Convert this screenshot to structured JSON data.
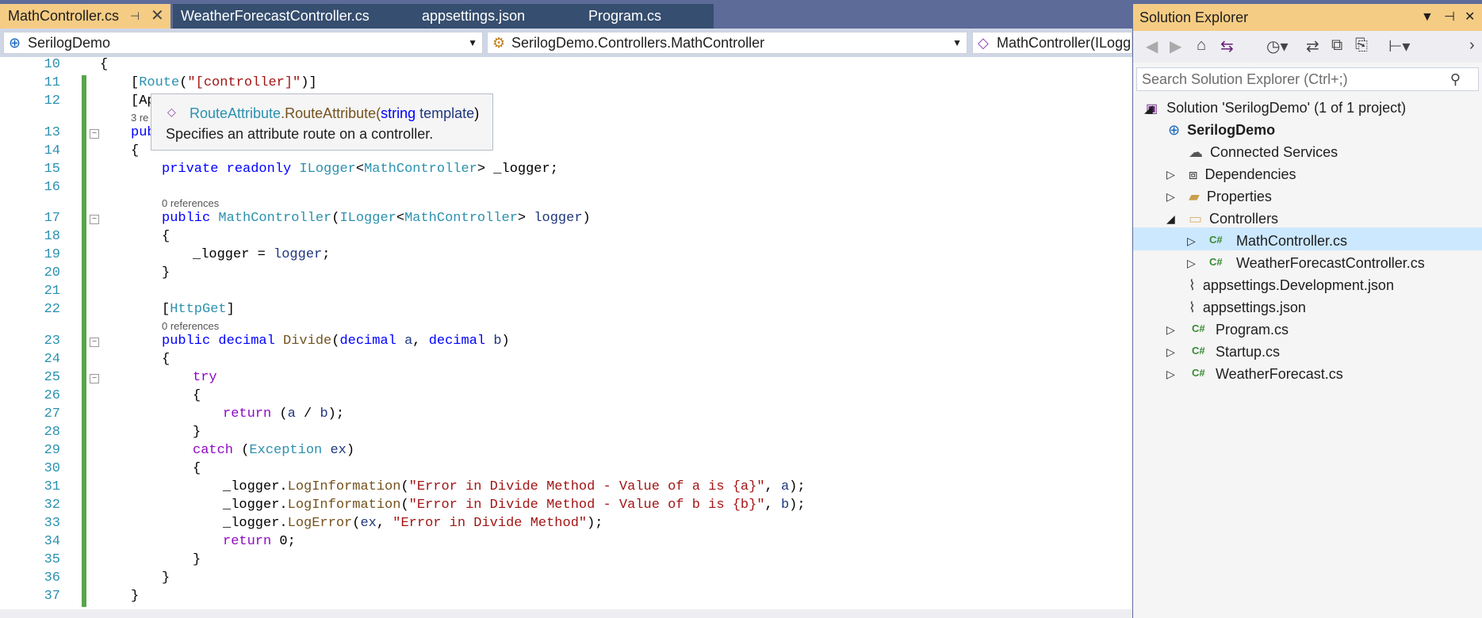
{
  "tabs": [
    {
      "label": "MathController.cs",
      "active": true
    },
    {
      "label": "WeatherForecastController.cs"
    },
    {
      "label": "appsettings.json"
    },
    {
      "label": "Program.cs"
    }
  ],
  "nav": {
    "project": "SerilogDemo",
    "type": "SerilogDemo.Controllers.MathController",
    "member": "MathController(ILogger<MathController> logger)"
  },
  "tooltip": {
    "signature_class": "RouteAttribute",
    "signature_method": ".RouteAttribute(",
    "signature_param_type": "string",
    "signature_param_name": " template",
    "signature_close": ")",
    "description": "Specifies an attribute route on a controller."
  },
  "code": {
    "line_numbers": [
      "10",
      "11",
      "12",
      "13",
      "14",
      "15",
      "16",
      "17",
      "18",
      "19",
      "20",
      "21",
      "22",
      "23",
      "24",
      "25",
      "26",
      "27",
      "28",
      "29",
      "30",
      "31",
      "32",
      "33",
      "34",
      "35",
      "36",
      "37"
    ],
    "lines": {
      "l10": "{",
      "l11_a": "[",
      "l11_b": "Route",
      "l11_c": "(",
      "l11_d": "\"[controller]\"",
      "l11_e": ")]",
      "l12": "[Ap",
      "ref13": "3 re",
      "l13": "pub",
      "l14": "{",
      "l15_kw": "private readonly ",
      "l15_t1": "ILogger",
      "l15_lt": "<",
      "l15_t2": "MathController",
      "l15_rest": "> _logger;",
      "ref17": "0 references",
      "l17_kw": "public ",
      "l17_t1": "MathController",
      "l17_p": "(",
      "l17_t2": "ILogger",
      "l17_lt": "<",
      "l17_t3": "MathController",
      "l17_gt": "> ",
      "l17_pn": "logger",
      "l17_end": ")",
      "l18": "{",
      "l19_a": "_logger = ",
      "l19_b": "logger",
      "l19_c": ";",
      "l20": "}",
      "l22_a": "[",
      "l22_b": "HttpGet",
      "l22_c": "]",
      "ref23": "0 references",
      "l23_kw": "public decimal ",
      "l23_m": "Divide",
      "l23_p": "(",
      "l23_k2": "decimal ",
      "l23_a": "a",
      "l23_c": ", ",
      "l23_k3": "decimal ",
      "l23_b": "b",
      "l23_e": ")",
      "l24": "{",
      "l25": "try",
      "l26": "{",
      "l27_kw": "return ",
      "l27_a": "(",
      "l27_pa": "a",
      "l27_b": " / ",
      "l27_pb": "b",
      "l27_c": ");",
      "l28": "}",
      "l29_kw": "catch ",
      "l29_a": "(",
      "l29_t": "Exception",
      "l29_b": " ",
      "l29_v": "ex",
      "l29_c": ")",
      "l30": "{",
      "l31_a": "_logger.",
      "l31_m": "LogInformation",
      "l31_b": "(",
      "l31_s": "\"Error in Divide Method - Value of a is {a}\"",
      "l31_c": ", ",
      "l31_p": "a",
      "l31_d": ");",
      "l32_a": "_logger.",
      "l32_m": "LogInformation",
      "l32_b": "(",
      "l32_s": "\"Error in Divide Method - Value of b is {b}\"",
      "l32_c": ", ",
      "l32_p": "b",
      "l32_d": ");",
      "l33_a": "_logger.",
      "l33_m": "LogError",
      "l33_b": "(",
      "l33_p": "ex",
      "l33_c": ", ",
      "l33_s": "\"Error in Divide Method\"",
      "l33_d": ");",
      "l34_kw": "return ",
      "l34_b": "0;",
      "l35": "}",
      "l36": "}",
      "l37": "}"
    }
  },
  "solution_explorer": {
    "title": "Solution Explorer",
    "search_placeholder": "Search Solution Explorer (Ctrl+;)",
    "solution": "Solution 'SerilogDemo' (1 of 1 project)",
    "project": "SerilogDemo",
    "items": {
      "connected": "Connected Services",
      "dependencies": "Dependencies",
      "properties": "Properties",
      "controllers": "Controllers",
      "math": "MathController.cs",
      "weather_ctrl": "WeatherForecastController.cs",
      "appsettings_dev": "appsettings.Development.json",
      "appsettings": "appsettings.json",
      "program": "Program.cs",
      "startup": "Startup.cs",
      "weather": "WeatherForecast.cs"
    },
    "cs_badge": "C#"
  },
  "colors": {
    "accent": "#f5cc84",
    "chrome": "#5d6b99",
    "selected": "#cce8ff"
  }
}
